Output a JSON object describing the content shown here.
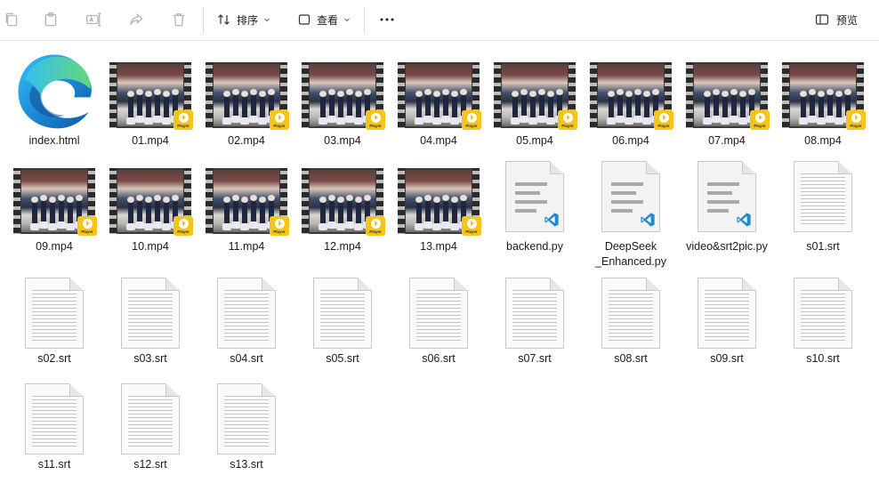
{
  "toolbar": {
    "sort_label": "排序",
    "view_label": "查看",
    "more_label": "···",
    "preview_label": "预览"
  },
  "files": [
    {
      "name": "index.html",
      "type": "edge"
    },
    {
      "name": "01.mp4",
      "type": "video"
    },
    {
      "name": "02.mp4",
      "type": "video"
    },
    {
      "name": "03.mp4",
      "type": "video"
    },
    {
      "name": "04.mp4",
      "type": "video"
    },
    {
      "name": "05.mp4",
      "type": "video"
    },
    {
      "name": "06.mp4",
      "type": "video"
    },
    {
      "name": "07.mp4",
      "type": "video"
    },
    {
      "name": "08.mp4",
      "type": "video"
    },
    {
      "name": "09.mp4",
      "type": "video"
    },
    {
      "name": "10.mp4",
      "type": "video"
    },
    {
      "name": "11.mp4",
      "type": "video"
    },
    {
      "name": "12.mp4",
      "type": "video"
    },
    {
      "name": "13.mp4",
      "type": "video"
    },
    {
      "name": "backend.py",
      "type": "python"
    },
    {
      "name": "DeepSeek_Enhanced.py",
      "type": "python"
    },
    {
      "name": "video&srt2pic.py",
      "type": "python"
    },
    {
      "name": "s01.srt",
      "type": "text"
    },
    {
      "name": "s02.srt",
      "type": "text"
    },
    {
      "name": "s03.srt",
      "type": "text"
    },
    {
      "name": "s04.srt",
      "type": "text"
    },
    {
      "name": "s05.srt",
      "type": "text"
    },
    {
      "name": "s06.srt",
      "type": "text"
    },
    {
      "name": "s07.srt",
      "type": "text"
    },
    {
      "name": "s08.srt",
      "type": "text"
    },
    {
      "name": "s09.srt",
      "type": "text"
    },
    {
      "name": "s10.srt",
      "type": "text"
    },
    {
      "name": "s11.srt",
      "type": "text"
    },
    {
      "name": "s12.srt",
      "type": "text"
    },
    {
      "name": "s13.srt",
      "type": "text"
    }
  ],
  "video_badge_text": "Player",
  "colors": {
    "badge": "#f5c518",
    "vscode_blue": "#1f8ad2",
    "edge_blue": "#0c59a4",
    "edge_green": "#5fd68b"
  }
}
